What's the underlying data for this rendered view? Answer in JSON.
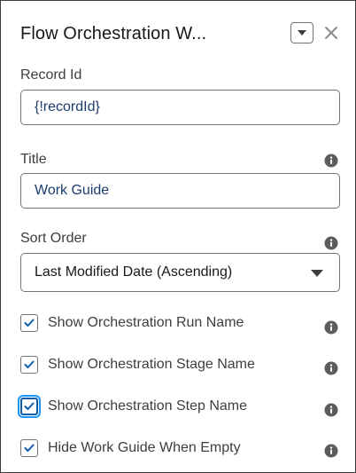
{
  "panel": {
    "title": "Flow Orchestration W...",
    "dropdown_icon": "chevron-down-icon",
    "close_icon": "close-icon"
  },
  "fields": {
    "record_id": {
      "label": "Record Id",
      "value": "{!recordId}"
    },
    "title": {
      "label": "Title",
      "value": "Work Guide",
      "info_icon": "info-icon"
    },
    "sort_order": {
      "label": "Sort Order",
      "selected": "Last Modified Date (Ascending)",
      "info_icon": "info-icon"
    }
  },
  "checkboxes": [
    {
      "label": "Show Orchestration Run Name",
      "checked": true
    },
    {
      "label": "Show Orchestration Stage Name",
      "checked": true
    },
    {
      "label": "Show Orchestration Step Name",
      "checked": true,
      "focused": true
    },
    {
      "label": "Hide Work Guide When Empty",
      "checked": true
    }
  ],
  "colors": {
    "accent": "#0b5cab",
    "border": "#747474",
    "input_text": "#1b3b6f",
    "info_icon": "#706e6b"
  }
}
